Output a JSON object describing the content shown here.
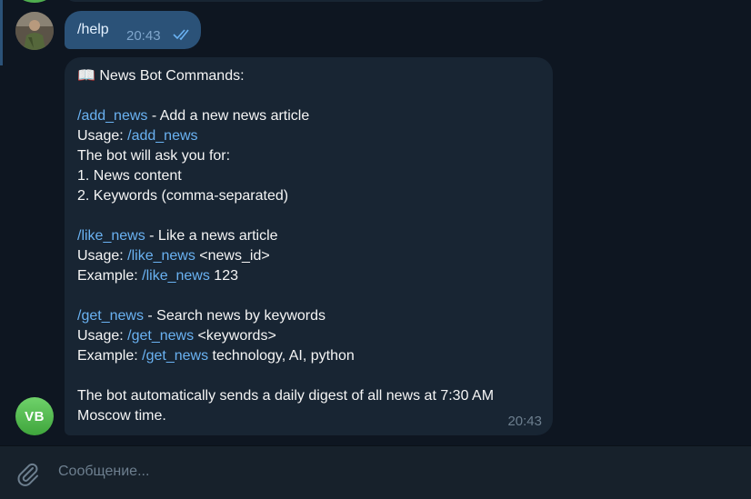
{
  "outgoing_message": {
    "text": "/help",
    "time": "20:43"
  },
  "incoming_message": {
    "header": "📖 News Bot Commands:",
    "add_news": {
      "command": "/add_news",
      "description": " - Add a new news article",
      "usage_label": "Usage: ",
      "usage_command": "/add_news",
      "ask_line": "The bot will ask you for:",
      "step1": "1. News content",
      "step2": "2. Keywords (comma-separated)"
    },
    "like_news": {
      "command": "/like_news",
      "description": " - Like a news article",
      "usage_label": "Usage: ",
      "usage_command": "/like_news",
      "usage_args": " <news_id>",
      "example_label": "Example: ",
      "example_command": "/like_news",
      "example_args": " 123"
    },
    "get_news": {
      "command": "/get_news",
      "description": " - Search news by keywords",
      "usage_label": "Usage: ",
      "usage_command": "/get_news",
      "usage_args": " <keywords>",
      "example_label": "Example: ",
      "example_command": "/get_news",
      "example_args": " technology, AI, python"
    },
    "footer_line1": "The bot automatically sends a daily digest of all news at 7:30 AM",
    "footer_line2": "Moscow time.",
    "time": "20:43"
  },
  "bot_avatar": {
    "initials": "VB"
  },
  "composer": {
    "placeholder": "Сообщение..."
  },
  "icons": {
    "attach": "paperclip-icon",
    "read_status": "double-check-icon"
  },
  "colors": {
    "background": "#0e1621",
    "outgoing_bubble": "#2b5278",
    "incoming_bubble": "#182533",
    "command_link": "#6ab2f2",
    "avatar_green": "#4fae4e"
  }
}
